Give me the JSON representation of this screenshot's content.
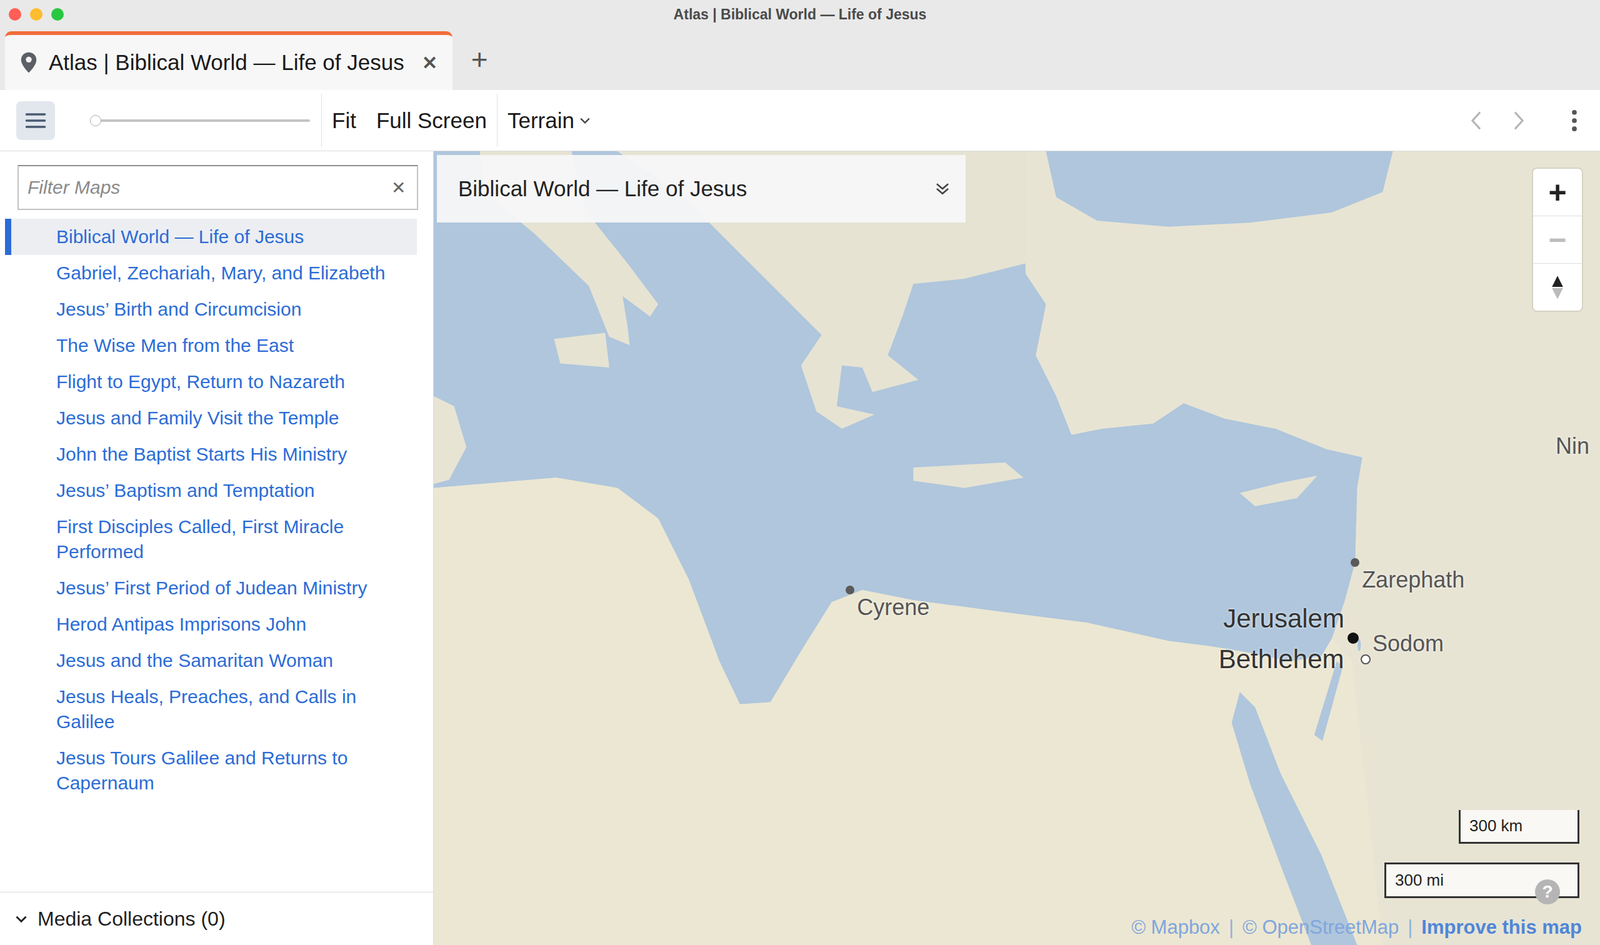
{
  "window": {
    "title": "Atlas | Biblical World — Life of Jesus"
  },
  "tabs": [
    {
      "label": "Atlas | Biblical World — Life of Jesus",
      "selected": true,
      "close": "✕"
    }
  ],
  "new_tab": "+",
  "toolbar": {
    "zoom_slider": {
      "level": 0
    },
    "buttons": [
      "Fit",
      "Full Screen"
    ],
    "layer": "Terrain",
    "back_disabled": true,
    "forward_disabled": true
  },
  "sidebar": {
    "filter": {
      "placeholder": "Filter Maps",
      "clear": "✕"
    },
    "items": [
      {
        "label": "Biblical World — Life of Jesus",
        "selected": true
      },
      {
        "label": "Gabriel, Zechariah, Mary, and Elizabeth",
        "selected": false
      },
      {
        "label": "Jesus’ Birth and Circumcision",
        "selected": false
      },
      {
        "label": "The Wise Men from the East",
        "selected": false
      },
      {
        "label": "Flight to Egypt, Return to Nazareth",
        "selected": false
      },
      {
        "label": "Jesus and Family Visit the Temple",
        "selected": false
      },
      {
        "label": "John the Baptist Starts His Ministry",
        "selected": false
      },
      {
        "label": "Jesus’ Baptism and Temptation",
        "selected": false
      },
      {
        "label": "First Disciples Called, First Miracle Performed",
        "selected": false
      },
      {
        "label": "Jesus’ First Period of Judean Ministry",
        "selected": false
      },
      {
        "label": "Herod Antipas Imprisons John",
        "selected": false
      },
      {
        "label": "Jesus and the Samaritan Woman",
        "selected": false
      },
      {
        "label": "Jesus Heals, Preaches, and Calls in Galilee",
        "selected": false
      },
      {
        "label": "Jesus Tours Galilee and Returns to Capernaum",
        "selected": false
      }
    ],
    "footer": {
      "label": "Media Collections (0)",
      "expanded": true
    }
  },
  "map": {
    "title": "Biblical World — Life of Jesus",
    "zoom_in": "+",
    "zoom_out": "−",
    "zoom_out_disabled": true,
    "places": [
      {
        "name": "Cyrene",
        "kind": "city"
      },
      {
        "name": "Zarephath",
        "kind": "city"
      },
      {
        "name": "Jerusalem",
        "kind": "capital"
      },
      {
        "name": "Bethlehem",
        "kind": "town"
      },
      {
        "name": "Sodom",
        "kind": "label"
      },
      {
        "name": "Nin",
        "kind": "label"
      }
    ],
    "scale": [
      "300 km",
      "300 mi"
    ],
    "help": "?",
    "separator": "|",
    "attribution": [
      {
        "text": "© Mapbox",
        "bold": false
      },
      {
        "text": "© OpenStreetMap",
        "bold": false
      },
      {
        "text": "Improve this map",
        "bold": true
      }
    ]
  }
}
